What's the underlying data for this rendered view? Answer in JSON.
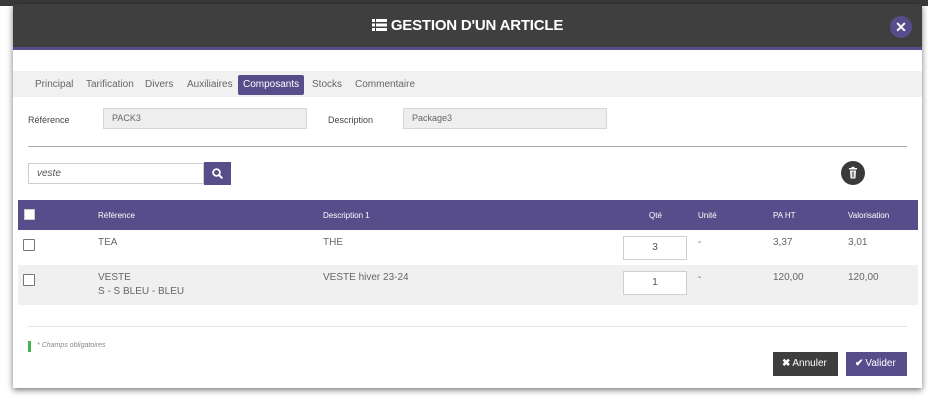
{
  "modal": {
    "title": "GESTION D'UN ARTICLE",
    "title_icon": "table-list-icon",
    "close_icon": "close-icon",
    "header_bg": "#3f3f3f",
    "accent": "#574d8a"
  },
  "tabs": [
    {
      "label": "Principal",
      "active": false
    },
    {
      "label": "Tarification",
      "active": false
    },
    {
      "label": "Divers",
      "active": false
    },
    {
      "label": "Auxiliaires",
      "active": false
    },
    {
      "label": "Composants",
      "active": true
    },
    {
      "label": "Stocks",
      "active": false
    },
    {
      "label": "Commentaire",
      "active": false
    }
  ],
  "form": {
    "reference_label": "Référence",
    "reference_value": "PACK3",
    "description_label": "Description",
    "description_value": "Package3"
  },
  "search": {
    "value": "veste",
    "button_icon": "search-icon",
    "delete_icon": "trash-icon"
  },
  "table": {
    "headers": {
      "reference": "Référence",
      "description": "Description 1",
      "qty": "Qté",
      "unit": "Unité",
      "pa_ht": "PA HT",
      "valorisation": "Valorisation"
    },
    "rows": [
      {
        "reference_line1": "TEA",
        "reference_line2": "",
        "description": "THE",
        "qty": "3",
        "unit": "-",
        "pa_ht": "3,37",
        "valorisation": "3,01",
        "checked": false
      },
      {
        "reference_line1": "VESTE",
        "reference_line2": "S - S BLEU - BLEU",
        "description": "VESTE hiver 23-24",
        "qty": "1",
        "unit": "-",
        "pa_ht": "120,00",
        "valorisation": "120,00",
        "checked": false
      }
    ]
  },
  "footer": {
    "mandatory_note": "* Champs obligatoires",
    "mandatory_color": "#4caf50",
    "cancel_label": "Annuler",
    "cancel_icon": "x-icon",
    "validate_label": "Valider",
    "validate_icon": "check-icon"
  }
}
